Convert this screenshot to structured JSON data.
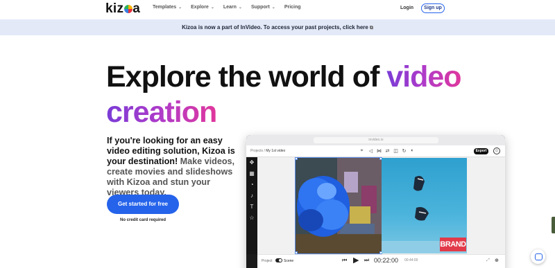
{
  "nav": {
    "logo": "kizoa",
    "menu": [
      {
        "label": "Templates",
        "dropdown": true
      },
      {
        "label": "Explore",
        "dropdown": true
      },
      {
        "label": "Learn",
        "dropdown": true
      },
      {
        "label": "Support",
        "dropdown": true
      },
      {
        "label": "Pricing",
        "dropdown": false
      }
    ],
    "login": "Login",
    "signup": "Sign up"
  },
  "banner": {
    "text": "Kizoa is now a part of InVideo. To access your past projects, click here",
    "icon": "external-link-icon"
  },
  "hero": {
    "title_plain": "Explore the world of ",
    "title_gradient_1": "video",
    "title_gradient_2": "creation",
    "subtitle_bold": "If you're looking for an easy video editing solution, Kizoa is your destination!",
    "subtitle_muted": " Make videos, create movies and slideshows with Kizoa and stun your viewers today.",
    "cta": "Get started for free",
    "cta_note": "No credit card required"
  },
  "editor_mock": {
    "url": "invideo.io",
    "breadcrumb_root": "Projects",
    "breadcrumb_sep": "/",
    "breadcrumb_current": "My 1st video",
    "export": "Export",
    "brand_text": "BRAND",
    "footer": {
      "project_label": "Project",
      "scene_label": "Scene",
      "time_current": "00:22:00",
      "time_total": "00:44:00"
    }
  },
  "colors": {
    "accent": "#2563eb",
    "banner_bg": "#e3e9f7",
    "gradient_start": "#7a3cd6",
    "gradient_end": "#e0379c"
  }
}
